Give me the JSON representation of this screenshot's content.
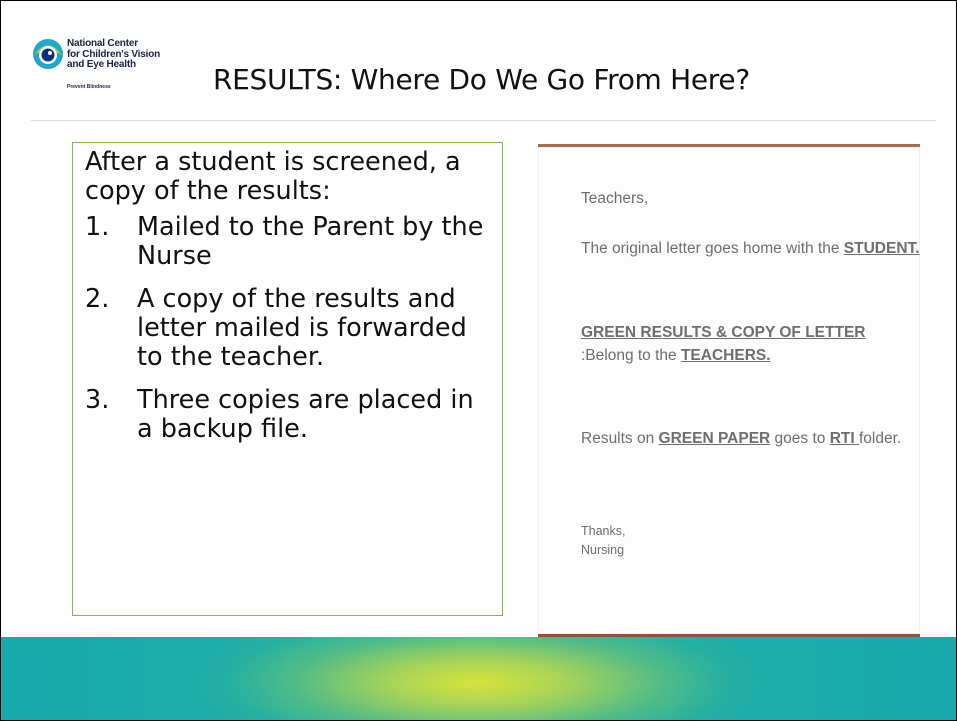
{
  "logo": {
    "line1": "National Center",
    "line2": "for Children's Vision",
    "line3": "and Eye Health",
    "tagline": "Prevent Blindness",
    "icon": "eye-logo-icon"
  },
  "title": "RESULTS: Where Do We Go From Here?",
  "textbox": {
    "intro": "After a student is screened, a copy of the results:",
    "steps": [
      {
        "num": "1.",
        "text": "Mailed to the Parent by the Nurse"
      },
      {
        "num": "2.",
        "text": "A copy of the results and letter mailed is forwarded to the teacher."
      },
      {
        "num": "3.",
        "text": "Three copies are placed in a backup file."
      }
    ]
  },
  "note": {
    "greeting": "Teachers,",
    "p1_a": "The original letter goes home with the ",
    "p1_b": "STUDENT.",
    "p2_a": "GREEN RESULTS & COPY OF LETTER",
    "p2_b": " :Belong to the ",
    "p2_c": "TEACHERS.",
    "p3_a": "Results on ",
    "p3_b": "GREEN PAPER",
    "p3_c": " goes to ",
    "p3_d": "RTI ",
    "p3_e": "folder.",
    "sign1": "Thanks,",
    "sign2": "Nursing"
  },
  "colors": {
    "accent_green": "#7dbb4a",
    "footer_teal": "#20aea8",
    "footer_yellow": "#d8e23a"
  }
}
